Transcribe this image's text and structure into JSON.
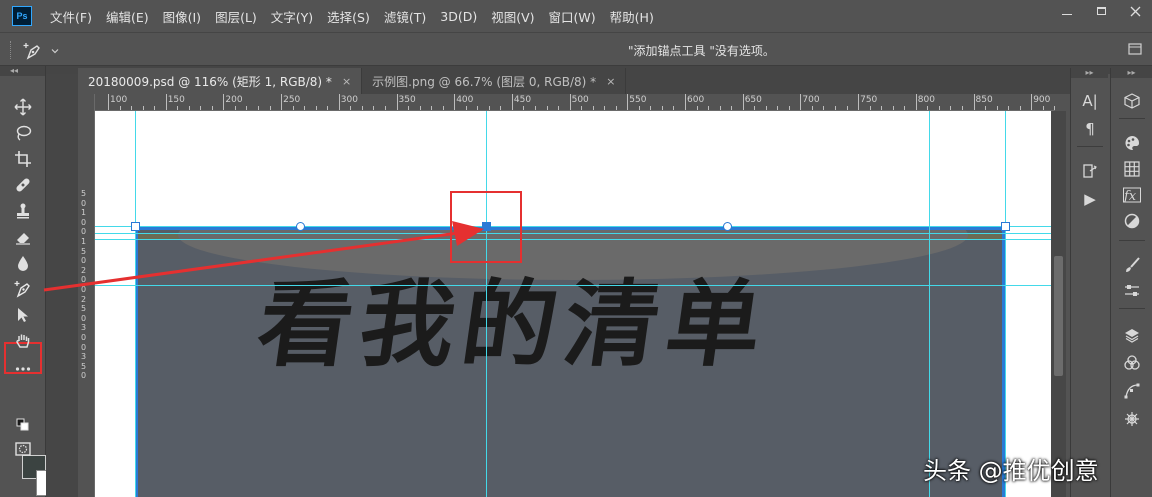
{
  "app": {
    "logo_text": "Ps"
  },
  "menu": [
    "文件(F)",
    "编辑(E)",
    "图像(I)",
    "图层(L)",
    "文字(Y)",
    "选择(S)",
    "滤镜(T)",
    "3D(D)",
    "视图(V)",
    "窗口(W)",
    "帮助(H)"
  ],
  "options_bar": {
    "hint": "\"添加锚点工具 \"没有选项。",
    "tool_icon": "add-anchor-pen-icon"
  },
  "panel_collapse_glyph": "◂◂",
  "panel_expand_glyph": "▸▸",
  "tabs": [
    {
      "label": "20180009.psd @ 116% (矩形 1, RGB/8) *",
      "close": "×",
      "active": true
    },
    {
      "label": "示例图.png @ 66.7% (图层 0, RGB/8) *",
      "close": "×",
      "active": false
    }
  ],
  "ruler_top": [
    "100",
    "150",
    "200",
    "250",
    "300",
    "350",
    "400",
    "450",
    "500",
    "550",
    "600",
    "650",
    "700",
    "750",
    "800",
    "850",
    "900"
  ],
  "ruler_left": [
    "5",
    "0",
    "1",
    "0",
    "0",
    "1",
    "5",
    "0",
    "2",
    "0",
    "0",
    "2",
    "5",
    "0",
    "3",
    "0",
    "0",
    "3",
    "5",
    "0"
  ],
  "canvas": {
    "headline": "看我的清单",
    "shape_color": "#575d66",
    "guide_color": "#43d9e9",
    "path_color": "#2a7ad5"
  },
  "swatches": {
    "foreground": "#3b4341",
    "background": "#ffffff"
  },
  "annotation_color": "#e53030",
  "right_panel_1": [
    "A|",
    "¶",
    "▶"
  ],
  "watermark": "头条 @推优创意"
}
